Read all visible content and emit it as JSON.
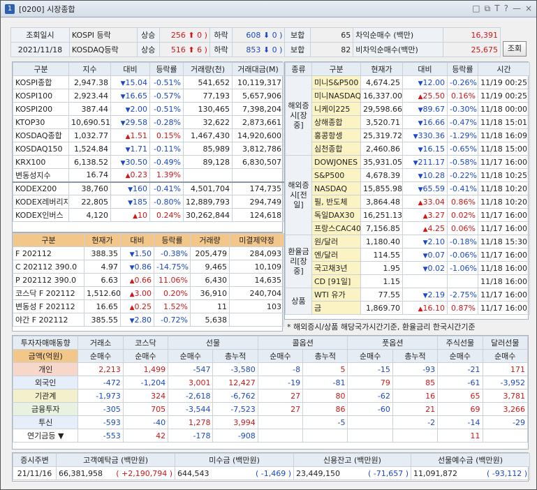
{
  "window": {
    "number": "1",
    "title": "[0200] 시장종합",
    "controls": [
      "□",
      "⧉",
      "T",
      "?",
      "—",
      "×"
    ]
  },
  "summary": {
    "label1": "조회일시",
    "date": "2021/11/18",
    "rows": [
      {
        "name": "KOSPI 등락",
        "up_label": "상승",
        "up": "256",
        "upper_label": "0",
        "down_label": "하락",
        "down": "608",
        "lower": "0",
        "flat_label": "보합",
        "flat": "65"
      },
      {
        "name": "KOSDAQ등락",
        "up_label": "상승",
        "up": "516",
        "upper_label": "6",
        "down_label": "하락",
        "down": "853",
        "lower": "0",
        "flat_label": "보합",
        "flat": "82"
      }
    ],
    "arb": [
      {
        "label": "차익순매수 (백만)",
        "value": "16,391"
      },
      {
        "label": "비차익순매수(백만)",
        "value": "25,675"
      }
    ],
    "query_button": "조회"
  },
  "index": {
    "headers": [
      "구분",
      "지수",
      "대비",
      "등락률",
      "거래량(천)",
      "거래대금(M)"
    ],
    "rows": [
      [
        "KOSPI종합",
        "2,947.38",
        "dn",
        "15.04",
        "-0.51%",
        "541,652",
        "10,119,317"
      ],
      [
        "KOSPI100",
        "2,923.44",
        "dn",
        "16.65",
        "-0.57%",
        "77,193",
        "5,657,906"
      ],
      [
        "KOSPI200",
        "387.44",
        "dn",
        "2.00",
        "-0.51%",
        "130,465",
        "7,398,204"
      ],
      [
        "KTOP30",
        "10,690.51",
        "dn",
        "29.58",
        "-0.28%",
        "32,622",
        "2,873,661"
      ],
      [
        "KOSDAQ종합",
        "1,032.77",
        "up",
        "1.51",
        "0.15%",
        "1,467,430",
        "14,920,600"
      ],
      [
        "KOSDAQ150",
        "1,524.84",
        "dn",
        "1.71",
        "-0.11%",
        "85,989",
        "3,812,786"
      ],
      [
        "KRX100",
        "6,138.52",
        "dn",
        "30.50",
        "-0.49%",
        "89,128",
        "6,830,507"
      ],
      [
        "변동성지수",
        "16.74",
        "up",
        "0.23",
        "1.39%",
        "",
        ""
      ]
    ],
    "etf": [
      [
        "KODEX200",
        "38,760",
        "dn",
        "160",
        "-0.41%",
        "4,501,704",
        "174,735"
      ],
      [
        "KODEX레버리지",
        "22,805",
        "dn",
        "185",
        "-0.80%",
        "12,889,793",
        "294,749"
      ],
      [
        "KODEX인버스",
        "4,120",
        "up",
        "10",
        "0.24%",
        "30,262,844",
        "124,618"
      ]
    ]
  },
  "futures": {
    "headers": [
      "구분",
      "현재가",
      "대비",
      "등락률",
      "거래량",
      "미결제약정"
    ],
    "rows": [
      [
        "F 202112",
        "388.35",
        "dn",
        "1.50",
        "-0.38%",
        "205,479",
        "284,093"
      ],
      [
        "C 202112 390.0",
        "4.97",
        "dn",
        "0.86",
        "-14.75%",
        "9,465",
        "10,109"
      ],
      [
        "P 202112 390.0",
        "6.63",
        "up",
        "0.66",
        "11.06%",
        "6,430",
        "14,635"
      ],
      [
        "코스닥 F 202112",
        "1,512.60",
        "up",
        "3.00",
        "0.20%",
        "36,910",
        "240,704"
      ],
      [
        "변동성 F 202112",
        "16.65",
        "up",
        "0.25",
        "1.52%",
        "11",
        "103"
      ],
      [
        "야간 F 202112",
        "385.55",
        "dn",
        "2.80",
        "-0.72%",
        "5,638",
        ""
      ]
    ]
  },
  "global": {
    "headers": [
      "종류",
      "구분",
      "현재가",
      "대비",
      "등락률",
      "시간"
    ],
    "groups": [
      {
        "name": "해외증시[장중]",
        "rows": [
          [
            "미니S&P500",
            "4,674.25",
            "dn",
            "12.00",
            "-0.26%",
            "11/19 00:25"
          ],
          [
            "미니NASDAQ",
            "16,337.00",
            "up",
            "25.50",
            "0.16%",
            "11/19 00:25"
          ],
          [
            "니케이225",
            "29,598.66",
            "dn",
            "89.67",
            "-0.30%",
            "11/18 00:00"
          ],
          [
            "상해종합",
            "3,520.71",
            "dn",
            "16.66",
            "-0.47%",
            "11/18 15:01"
          ],
          [
            "홍콩항셍",
            "25,319.72",
            "dn",
            "330.36",
            "-1.29%",
            "11/18 16:09"
          ],
          [
            "심천종합",
            "2,460.86",
            "dn",
            "16.15",
            "-0.65%",
            "11/18 15:00"
          ]
        ]
      },
      {
        "name": "해외증시[전일]",
        "rows": [
          [
            "DOWJONES",
            "35,931.05",
            "dn",
            "211.17",
            "-0.58%",
            "11/17 16:00"
          ],
          [
            "S&P500",
            "4,678.39",
            "dn",
            "10.28",
            "-0.22%",
            "11/18 10:25"
          ],
          [
            "NASDAQ",
            "15,855.98",
            "dn",
            "65.59",
            "-0.41%",
            "11/18 10:20"
          ],
          [
            "필, 반도체",
            "3,864.48",
            "up",
            "33.04",
            "0.86%",
            "11/18 10:20"
          ],
          [
            "독일DAX30",
            "16,251.13",
            "up",
            "3.27",
            "0.02%",
            "11/17 16:00"
          ],
          [
            "프랑스CAC40",
            "7,156.85",
            "up",
            "4.25",
            "0.06%",
            "11/17 16:00"
          ]
        ]
      },
      {
        "name": "환율금리[장중]",
        "rows": [
          [
            "원/달러",
            "1,180.40",
            "dn",
            "2.10",
            "-0.18%",
            "11/18 15:30"
          ],
          [
            "엔/달러",
            "114.55",
            "dn",
            "0.07",
            "-0.06%",
            "11/17 16:00"
          ],
          [
            "국고채3년",
            "1.95",
            "dn",
            "0.02",
            "-1.06%",
            "11/18 16:00"
          ],
          [
            "CD [91일]",
            "1.15",
            "",
            "",
            "",
            "11/18 16:00"
          ]
        ]
      },
      {
        "name": "상품",
        "rows": [
          [
            "WTI 유가",
            "77.55",
            "dn",
            "2.19",
            "-2.75%",
            "11/17 16:00"
          ],
          [
            "금",
            "1,869.70",
            "up",
            "16.10",
            "0.87%",
            "11/17 16:00"
          ]
        ]
      }
    ],
    "note": "* 해외증시/상품 해당국가시간기준, 환율금리 한국시간기준"
  },
  "investor": {
    "title": "투자자매매동향",
    "unit": "금액(억원)",
    "cols": [
      "거래소",
      "코스닥",
      "선물",
      "콜옵션",
      "풋옵션",
      "주식선물",
      "달러선물"
    ],
    "sub": [
      "순매수",
      "순매수",
      "순매수",
      "총누적",
      "순매수",
      "총누적",
      "순매수",
      "총누적",
      "순매수",
      "순매수"
    ],
    "rows": [
      {
        "name": "개인",
        "vals": [
          "2,213",
          "1,499",
          "-547",
          "-3,580",
          "-8",
          "5",
          "-15",
          "-93",
          "-21",
          "171"
        ]
      },
      {
        "name": "외국인",
        "vals": [
          "-472",
          "-1,204",
          "3,001",
          "12,427",
          "-19",
          "-81",
          "79",
          "85",
          "-61",
          "-3,952"
        ]
      },
      {
        "name": "기관계",
        "vals": [
          "-1,973",
          "324",
          "-2,618",
          "-6,762",
          "27",
          "80",
          "-62",
          "16",
          "65",
          "3,781"
        ]
      },
      {
        "name": "금융투자",
        "vals": [
          "-305",
          "705",
          "-3,544",
          "-7,523",
          "27",
          "86",
          "-60",
          "21",
          "69",
          "3,266"
        ]
      },
      {
        "name": "투신",
        "vals": [
          "-593",
          "-40",
          "1,278",
          "3,994",
          "",
          "-5",
          "",
          "-2",
          "-14",
          "-29"
        ]
      },
      {
        "name": "연기금등",
        "vals": [
          "-553",
          "42",
          "-178",
          "-908",
          "",
          "",
          "",
          "",
          "11",
          ""
        ]
      }
    ]
  },
  "deposit": {
    "headers": [
      "증시주변",
      "고객예탁금 (백만원)",
      "미수금 (백만원)",
      "신용잔고 (백만원)",
      "선물예수금 (백만원)"
    ],
    "date": "21/11/16",
    "vals": [
      [
        "66,381,958",
        "+2,190,794"
      ],
      [
        "644,543",
        "-1,469"
      ],
      [
        "23,449,150",
        "-71,657"
      ],
      [
        "11,091,872",
        "-93,112"
      ]
    ]
  },
  "colors": {
    "up": "#d01818",
    "down": "#1a48c8",
    "header": "#e6ecf4",
    "orange": "#f3c68a"
  }
}
